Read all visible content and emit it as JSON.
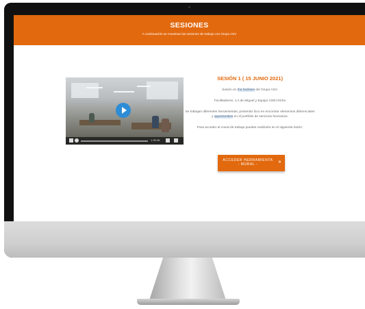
{
  "banner": {
    "title": "SESIONES",
    "subtitle": "A continuación se muestran las sesiones de trabajo con Grupo ASV"
  },
  "session": {
    "heading": "SESIÓN 1 ( 15 JUNIO 2021)",
    "line1_pre": "Sesión en ",
    "line1_hl": "the facilities",
    "line1_post": " del Grupo ASV.",
    "line2": "Facilitadores: J.A de Miguel y Equipo CEEI Elche",
    "line3_pre": "Se trabajan diferentes herramientas, poniendo foco en encontrar elementos diferenciales y ",
    "line3_hl": "opportunities",
    "line3_post": " en el portfolio de servicios funerarios.",
    "line4": "Para acceder al mural de trabajo puedes realizarlo en el siguiente botón:"
  },
  "button": {
    "label_line1": "ACCEDER HERRAMIENTA",
    "label_line2": "- MURAL -",
    "icon": "double-chevron-right-icon"
  },
  "video": {
    "play_icon": "play-icon",
    "time": "1:35:08"
  },
  "colors": {
    "accent": "#e2690e",
    "play": "#2d8cd6"
  }
}
